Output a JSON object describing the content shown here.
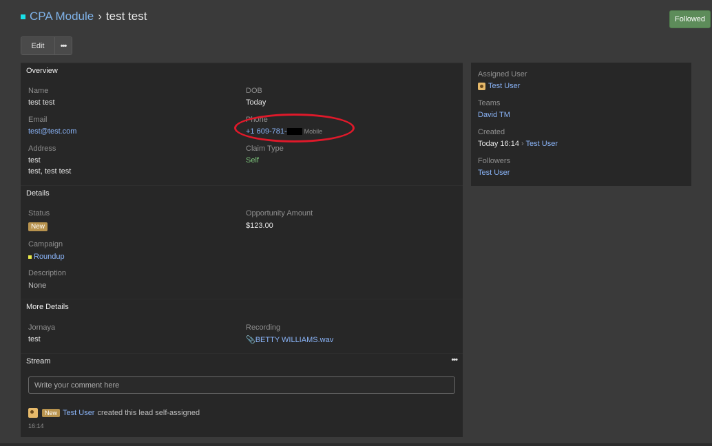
{
  "header": {
    "module": "CPA Module",
    "separator": "›",
    "record_name": "test test",
    "followed_label": "Followed"
  },
  "actions": {
    "edit_label": "Edit",
    "more_label": "•••"
  },
  "overview": {
    "title": "Overview",
    "name_label": "Name",
    "name_value": "test test",
    "dob_label": "DOB",
    "dob_value": "Today",
    "email_label": "Email",
    "email_value": "test@test.com",
    "phone_label": "Phone",
    "phone_value": "+1 609-781-",
    "phone_type": "Mobile",
    "address_label": "Address",
    "address_line1": "test",
    "address_line2": "test, test test",
    "claim_type_label": "Claim Type",
    "claim_type_value": "Self"
  },
  "details": {
    "title": "Details",
    "status_label": "Status",
    "status_value": "New",
    "opportunity_label": "Opportunity Amount",
    "opportunity_value": "$123.00",
    "campaign_label": "Campaign",
    "campaign_value": "Roundup",
    "description_label": "Description",
    "description_value": "None"
  },
  "more_details": {
    "title": "More Details",
    "jornaya_label": "Jornaya",
    "jornaya_value": "test",
    "recording_label": "Recording",
    "recording_value": "BETTY WILLIAMS.wav"
  },
  "stream": {
    "title": "Stream",
    "more_label": "•••",
    "comment_placeholder": "Write your comment here",
    "entry_badge": "New",
    "entry_user": "Test User",
    "entry_text": "created this lead self-assigned",
    "entry_time": "16:14"
  },
  "side": {
    "assigned_user_label": "Assigned User",
    "assigned_user_value": "Test User",
    "teams_label": "Teams",
    "teams_value": "David TM",
    "created_label": "Created",
    "created_value": "Today 16:14",
    "created_sep": "›",
    "created_by": "Test User",
    "followers_label": "Followers",
    "followers_value": "Test User"
  },
  "colors": {
    "accent_link": "#8ab4f8",
    "followed_green": "#5d8c5a",
    "status_badge": "#b8934e",
    "annotation_red": "#e0192a"
  }
}
